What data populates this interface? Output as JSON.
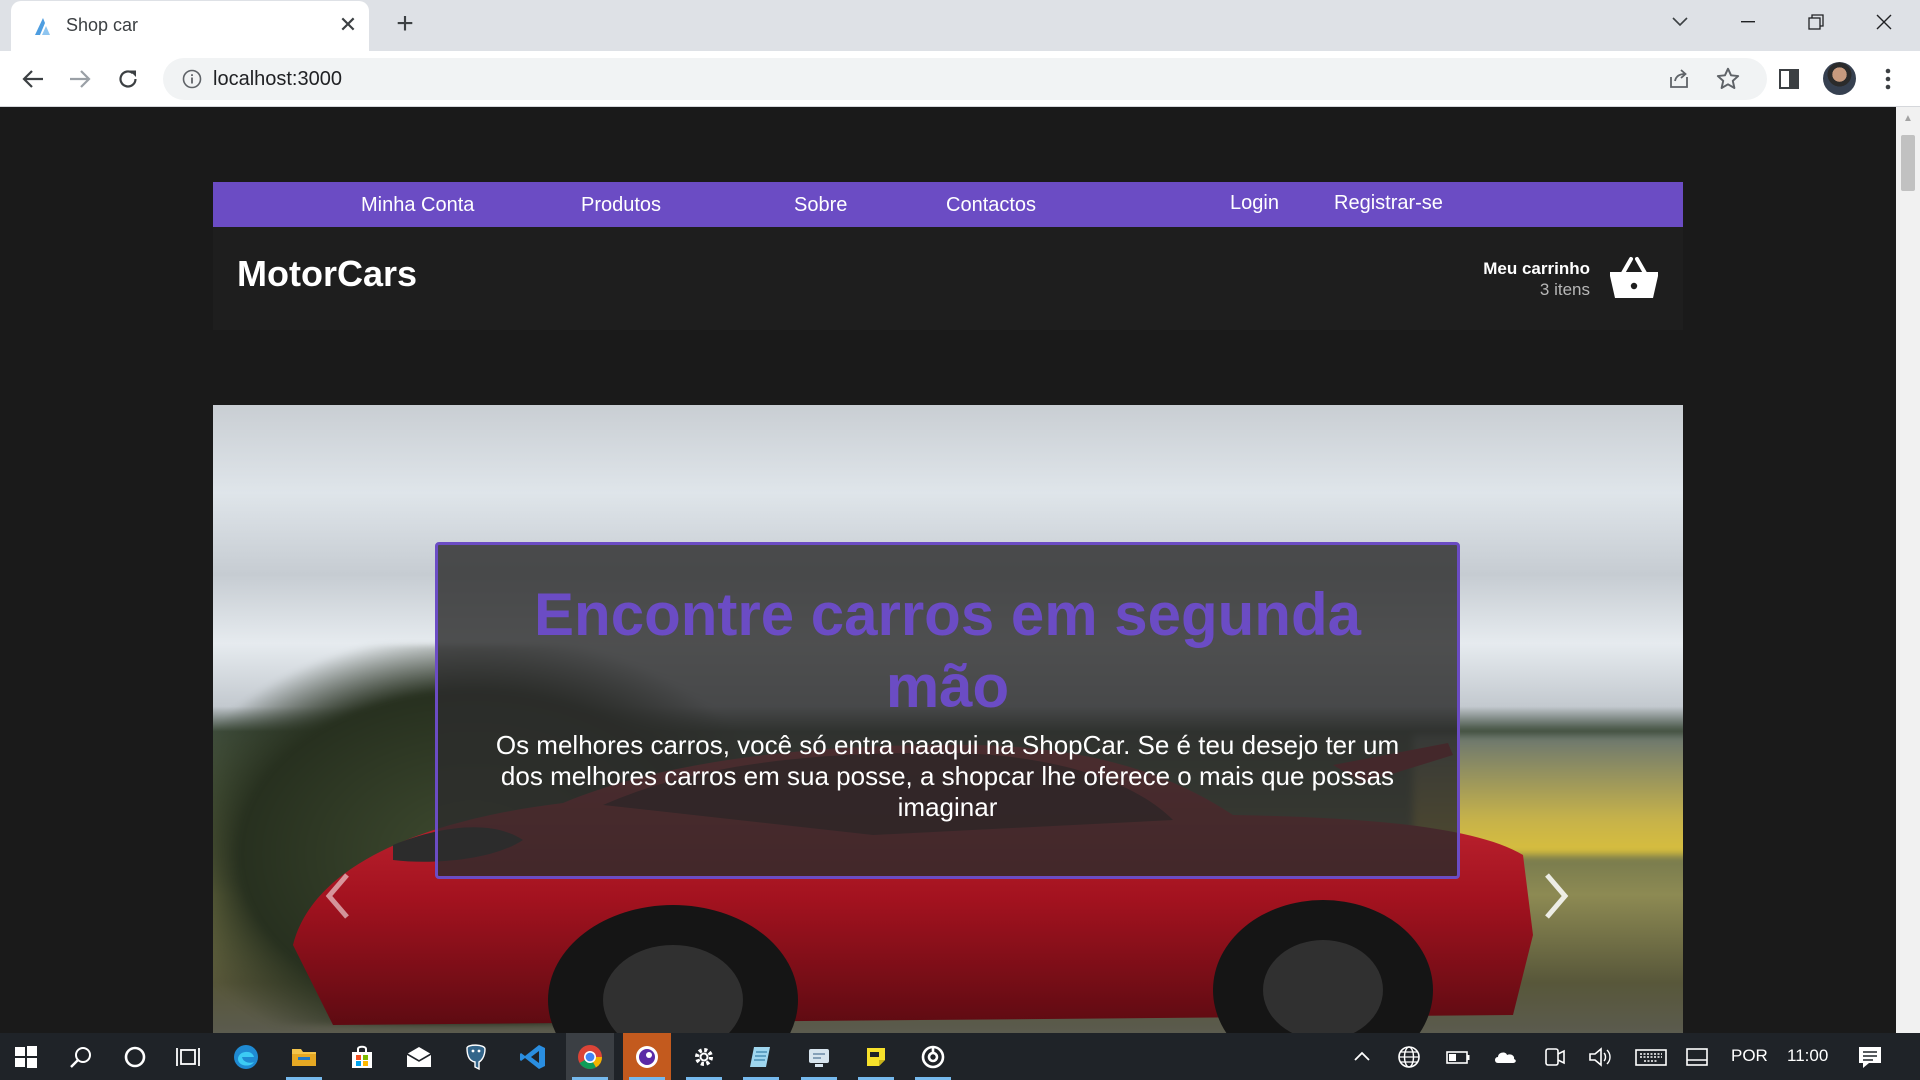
{
  "browser": {
    "tab": {
      "title": "Shop car",
      "close_glyph": "✕"
    },
    "new_tab_glyph": "+",
    "url": "localhost:3000"
  },
  "page": {
    "nav": {
      "links": [
        "Minha Conta",
        "Produtos",
        "Sobre",
        "Contactos"
      ],
      "login": "Login",
      "register": "Registrar-se"
    },
    "header": {
      "brand": "MotorCars",
      "cart_title": "Meu carrinho",
      "cart_count": "3 itens"
    },
    "hero": {
      "title": "Encontre carros em segunda mão",
      "text": "Os melhores carros, você só entra naaqui na ShopCar. Se é teu desejo ter um dos melhores carros em sua posse, a shopcar lhe oferece o mais que possas imaginar"
    }
  },
  "taskbar": {
    "language": "POR",
    "time": "11:00",
    "apps": [
      "windows-start-icon",
      "search-icon",
      "cortana-icon",
      "task-view-icon",
      "edge-icon",
      "file-explorer-icon",
      "store-icon",
      "mail-icon",
      "postgres-icon",
      "vscode-icon",
      "chrome-icon",
      "browser-app-icon",
      "settings-icon",
      "notepad-icon",
      "remote-desktop-icon",
      "sticky-notes-icon",
      "app-circle-icon"
    ]
  },
  "colors": {
    "accent_purple": "#6b4cc4",
    "page_background": "#1a1a1a",
    "header_background": "#1e1e1e"
  }
}
